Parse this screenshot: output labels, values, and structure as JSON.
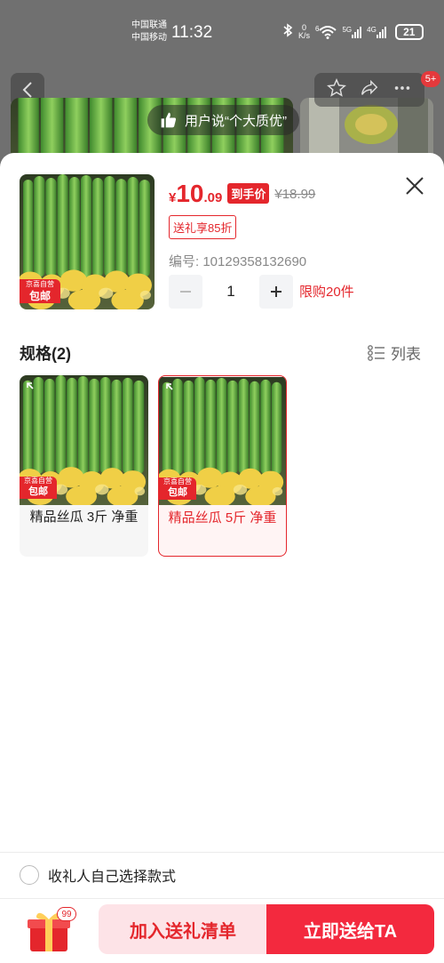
{
  "status_bar": {
    "carrier_1": "中国联通",
    "carrier_2": "中国移动",
    "time": "11:32",
    "net_speed_value": "0",
    "net_speed_unit": "K/s",
    "wifi_label": "6",
    "signal_1_label": "5G",
    "signal_2_label": "4G",
    "battery": "21"
  },
  "background_page": {
    "cart_badge": "5+",
    "praise_text": "用户说“个大质优”"
  },
  "product": {
    "price_symbol": "¥",
    "price_integer": "10",
    "price_decimal": ".09",
    "price_tag": "到手价",
    "original_price": "¥18.99",
    "gift_discount": "送礼享85折",
    "sku_code": "编号: 10129358132690",
    "quantity": "1",
    "purchase_limit": "限购20件",
    "badge_top": "京喜自营",
    "badge_bottom": "包邮"
  },
  "specs": {
    "title": "规格(2)",
    "list_toggle_label": "列表",
    "options": [
      {
        "label": "精品丝瓜 3斤 净重",
        "selected": false
      },
      {
        "label": "精品丝瓜 5斤 净重",
        "selected": true
      }
    ]
  },
  "recipient_option": "收礼人自己选择款式",
  "footer": {
    "gift_badge": "99",
    "add_button": "加入送礼清单",
    "send_button": "立即送给TA"
  },
  "colors": {
    "accent_red": "#e4262c",
    "send_button_red": "#f3293e",
    "add_button_pink": "#fde3e7"
  }
}
